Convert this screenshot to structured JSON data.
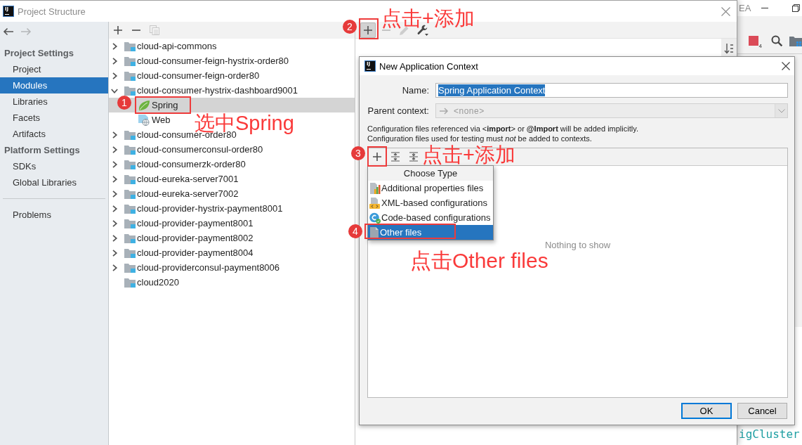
{
  "background_window": {
    "title": "EA",
    "toolbar_badge": "4",
    "code_line": "igCluster"
  },
  "window": {
    "logo": "IJ",
    "title": "Project Structure"
  },
  "nav": [
    {
      "kind": "back",
      "disabled": false
    },
    {
      "kind": "forward",
      "disabled": true
    }
  ],
  "sidebar": {
    "groups": [
      {
        "title": "Project Settings",
        "items": [
          {
            "label": "Project",
            "selected": false
          },
          {
            "label": "Modules",
            "selected": true
          },
          {
            "label": "Libraries",
            "selected": false
          },
          {
            "label": "Facets",
            "selected": false
          },
          {
            "label": "Artifacts",
            "selected": false
          }
        ]
      },
      {
        "title": "Platform Settings",
        "items": [
          {
            "label": "SDKs",
            "selected": false
          },
          {
            "label": "Global Libraries",
            "selected": false
          }
        ]
      }
    ],
    "footer_items": [
      {
        "label": "Problems",
        "selected": false
      }
    ]
  },
  "module_toolbar": [
    {
      "kind": "add",
      "disabled": false
    },
    {
      "kind": "remove",
      "disabled": false
    },
    {
      "kind": "copy",
      "disabled": true
    }
  ],
  "modules": [
    {
      "label": "cloud-api-commons",
      "expandable": true,
      "expanded": false,
      "selected": false
    },
    {
      "label": "cloud-consumer-feign-hystrix-order80",
      "expandable": true,
      "expanded": false,
      "selected": false
    },
    {
      "label": "cloud-consumer-feign-order80",
      "expandable": true,
      "expanded": false,
      "selected": false
    },
    {
      "label": "cloud-consumer-hystrix-dashboard9001",
      "expandable": true,
      "expanded": true,
      "selected": false,
      "children": [
        {
          "label": "Spring",
          "kind": "spring",
          "selected": true
        },
        {
          "label": "Web",
          "kind": "web",
          "selected": false
        }
      ]
    },
    {
      "label": "cloud-consumer-order80",
      "expandable": true,
      "expanded": false,
      "selected": false
    },
    {
      "label": "cloud-consumerconsul-order80",
      "expandable": true,
      "expanded": false,
      "selected": false
    },
    {
      "label": "cloud-consumerzk-order80",
      "expandable": true,
      "expanded": false,
      "selected": false
    },
    {
      "label": "cloud-eureka-server7001",
      "expandable": true,
      "expanded": false,
      "selected": false
    },
    {
      "label": "cloud-eureka-server7002",
      "expandable": true,
      "expanded": false,
      "selected": false
    },
    {
      "label": "cloud-provider-hystrix-payment8001",
      "expandable": true,
      "expanded": false,
      "selected": false
    },
    {
      "label": "cloud-provider-payment8001",
      "expandable": true,
      "expanded": false,
      "selected": false
    },
    {
      "label": "cloud-provider-payment8002",
      "expandable": true,
      "expanded": false,
      "selected": false
    },
    {
      "label": "cloud-provider-payment8004",
      "expandable": true,
      "expanded": false,
      "selected": false
    },
    {
      "label": "cloud-providerconsul-payment8006",
      "expandable": true,
      "expanded": false,
      "selected": false
    },
    {
      "label": "cloud2020",
      "expandable": false,
      "selected": false
    }
  ],
  "facet_toolbar": [
    {
      "kind": "add",
      "disabled": false,
      "pressed": true
    },
    {
      "kind": "remove",
      "disabled": true,
      "pressed": false
    },
    {
      "kind": "edit",
      "disabled": true,
      "pressed": false
    },
    {
      "kind": "settings",
      "disabled": false,
      "pressed": false
    }
  ],
  "dialog": {
    "logo": "IJ",
    "title": "New Application Context",
    "name": {
      "label": "Name:",
      "value": "Spring Application Context",
      "text_selected": true
    },
    "parent_context": {
      "label": "Parent context:",
      "value": "<none>",
      "disabled": true
    },
    "notes": [
      "Configuration files referenced via <**import**> or **@Import** will be added implicitly.",
      "Configuration files used for testing must *not* be added to contexts."
    ],
    "files_toolbar": [
      {
        "kind": "add"
      },
      {
        "kind": "expand_all"
      },
      {
        "kind": "collapse_all"
      }
    ],
    "empty_text": "Nothing to show",
    "popup": {
      "title": "Choose Type",
      "items": [
        {
          "label": "Additional properties files",
          "kind": "properties",
          "selected": false
        },
        {
          "label": "XML-based configurations",
          "kind": "xml",
          "selected": false
        },
        {
          "label": "Code-based configurations",
          "kind": "code",
          "selected": false
        },
        {
          "label": "Other files",
          "kind": "other",
          "selected": true
        }
      ]
    },
    "buttons": [
      {
        "label": "OK",
        "default": true
      },
      {
        "label": "Cancel",
        "default": false
      }
    ]
  },
  "annotations": [
    {
      "number": "1",
      "note": "选中Spring"
    },
    {
      "number": "2",
      "note": "点击+添加"
    },
    {
      "number": "3",
      "note": "点击+添加"
    },
    {
      "number": "4",
      "note": "点击Other files"
    }
  ]
}
